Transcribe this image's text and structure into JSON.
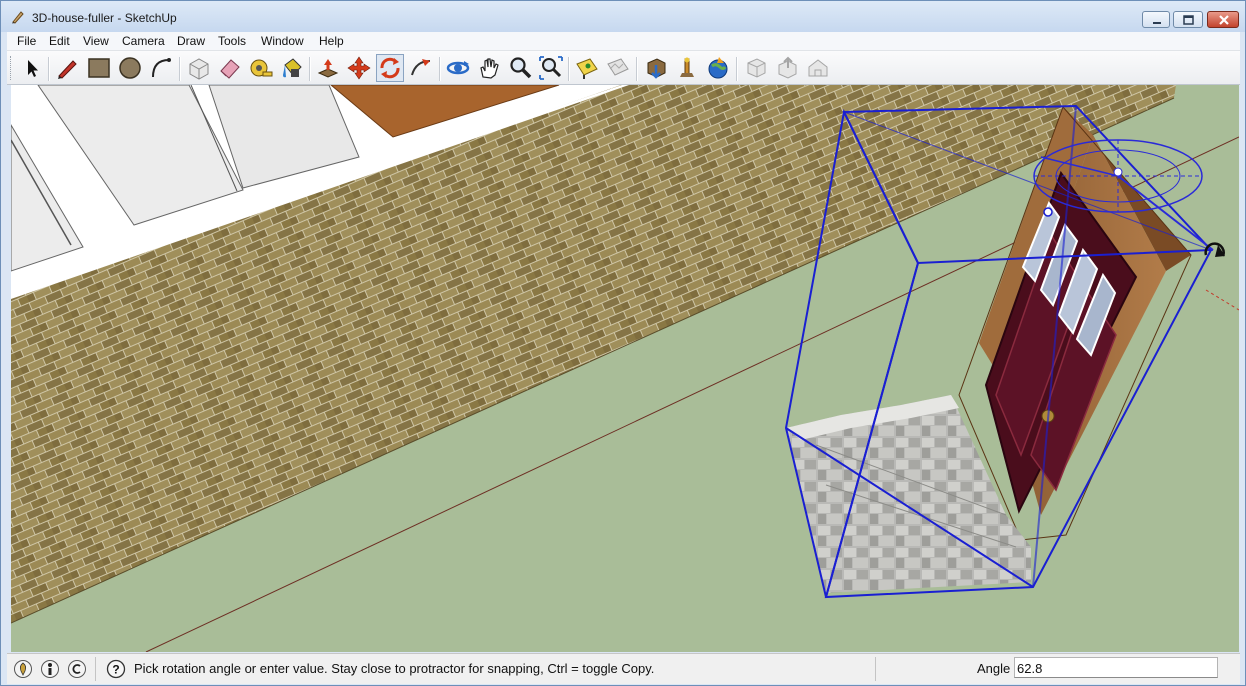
{
  "window": {
    "title": "3D-house-fuller - SketchUp",
    "controls": [
      "minimize-button",
      "maximize-button",
      "close-button"
    ]
  },
  "menu": [
    "File",
    "Edit",
    "View",
    "Camera",
    "Draw",
    "Tools",
    "Window",
    "Help"
  ],
  "toolbar": {
    "tools": [
      "select-icon",
      "pencil-icon",
      "rectangle-icon",
      "circle-icon",
      "arc-icon",
      "make-component-icon",
      "eraser-icon",
      "tape-measure-icon",
      "paint-bucket-icon",
      "push-pull-icon",
      "move-icon",
      "rotate-icon",
      "follow-me-icon",
      "orbit-icon",
      "pan-icon",
      "zoom-icon",
      "zoom-extents-icon",
      "add-location-icon",
      "toggle-terrain-icon",
      "get-models-icon",
      "share-model-icon",
      "google-earth-icon",
      "get-models-gray-icon",
      "share-model-gray-icon",
      "share-component-gray-icon"
    ]
  },
  "status": {
    "icons": [
      "geo-location-icon",
      "credits-icon",
      "copyright-icon",
      "help-icon"
    ],
    "message": "Pick rotation angle or enter value.  Stay close to protractor for snapping, Ctrl = toggle Copy.",
    "measurement_label": "Angle",
    "measurement_value": "62.8"
  },
  "colors": {
    "ground": "#a9bd98",
    "brick": "#8e7c48",
    "floor_wood": "#a8642d",
    "selection": "#1a1fd2",
    "door": "#4a0d1c"
  }
}
